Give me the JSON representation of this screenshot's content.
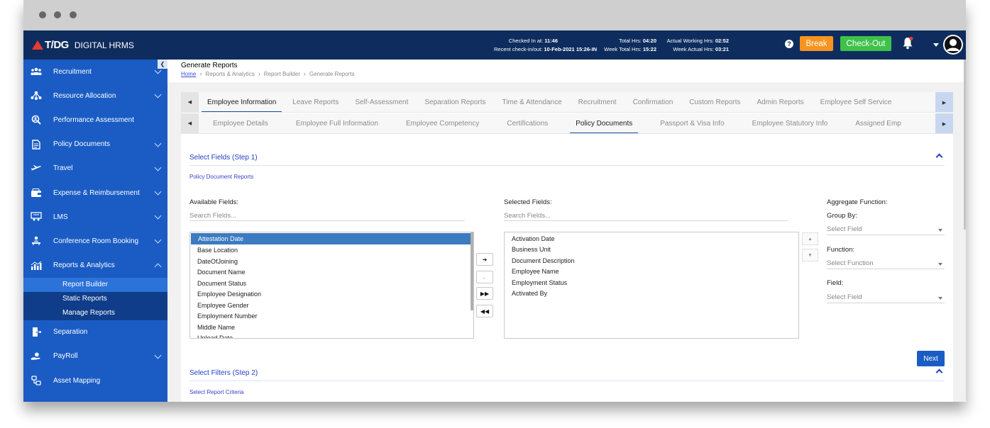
{
  "header": {
    "logo_brand": "T/DG",
    "logo_name": "DIGITAL HRMS",
    "checked_in_label": "Checked In at:",
    "checked_in_value": "11:46",
    "recent_label": "Recent check-in/out:",
    "recent_value": "10-Feb-2021 15:26-IN",
    "total_hrs_label": "Total Hrs:",
    "total_hrs_value": "04:20",
    "week_total_label": "Week Total Hrs:",
    "week_total_value": "15:22",
    "actual_working_label": "Actual Working Hrs:",
    "actual_working_value": "02:52",
    "week_actual_label": "Week Actual Hrs:",
    "week_actual_value": "03:21",
    "break_label": "Break",
    "checkout_label": "Check-Out",
    "help_icon": "?",
    "colors": {
      "bar": "#0e2d5e",
      "break": "#f7931e",
      "checkout": "#3ec24a",
      "notify_dot": "#e63b2e"
    }
  },
  "sidebar": {
    "items": [
      {
        "label": "Recruitment",
        "icon": "people-icon",
        "expandable": true
      },
      {
        "label": "Resource Allocation",
        "icon": "network-icon",
        "expandable": true
      },
      {
        "label": "Performance Assessment",
        "icon": "search-person-icon",
        "expandable": false
      },
      {
        "label": "Policy Documents",
        "icon": "document-icon",
        "expandable": true
      },
      {
        "label": "Travel",
        "icon": "plane-icon",
        "expandable": true
      },
      {
        "label": "Expense & Reimbursement",
        "icon": "wallet-icon",
        "expandable": true
      },
      {
        "label": "LMS",
        "icon": "classroom-icon",
        "expandable": true
      },
      {
        "label": "Conference Room Booking",
        "icon": "meeting-icon",
        "expandable": true
      },
      {
        "label": "Reports & Analytics",
        "icon": "bar-chart-icon",
        "expandable": true,
        "open": true
      }
    ],
    "sub_items": [
      {
        "label": "Report Builder",
        "active": true
      },
      {
        "label": "Static Reports",
        "active": false
      },
      {
        "label": "Manage Reports",
        "active": false
      }
    ],
    "items_after": [
      {
        "label": "Separation",
        "icon": "exit-icon",
        "expandable": false
      },
      {
        "label": "PayRoll",
        "icon": "money-hand-icon",
        "expandable": true
      },
      {
        "label": "Asset Mapping",
        "icon": "asset-icon",
        "expandable": false
      }
    ]
  },
  "page": {
    "title": "Generate Reports",
    "breadcrumbs": [
      "Home",
      "Reports & Analytics",
      "Report Builder",
      "Generate Reports"
    ]
  },
  "tabs_primary": [
    "Employee Information",
    "Leave Reports",
    "Self-Assessment",
    "Separation Reports",
    "Time & Attendance",
    "Recruitment",
    "Confirmation",
    "Custom Reports",
    "Admin Reports",
    "Employee Self Service"
  ],
  "tabs_primary_active": 0,
  "tabs_secondary": [
    "Employee Details",
    "Employee Full Information",
    "Employee Competency",
    "Certifications",
    "Policy Documents",
    "Passport & Visa Info",
    "Employee Statutory Info",
    "Assigned Emp"
  ],
  "tabs_secondary_active": 4,
  "step1": {
    "title": "Select Fields (Step 1)",
    "link": "Policy Document Reports",
    "available_label": "Available Fields:",
    "selected_label": "Selected Fields:",
    "search_placeholder": "Search Fields...",
    "available_fields": [
      "Attestation Date",
      "Base Location",
      "DateOfJoining",
      "Document Name",
      "Document Status",
      "Employee Designation",
      "Employee Gender",
      "Employment Number",
      "Middle Name",
      "Upload Date"
    ],
    "available_selected_index": 0,
    "selected_fields": [
      "Activation Date",
      "Business Unit",
      "Document Description",
      "Employee Name",
      "Employment Status",
      "Activated By"
    ],
    "aggregate_label": "Aggregate Function:",
    "group_by_label": "Group By:",
    "group_by_value": "Select Field",
    "function_label": "Function:",
    "function_value": "Select Function",
    "field_label": "Field:",
    "field_value": "Select Field",
    "next_label": "Next"
  },
  "step2": {
    "title": "Select Filters (Step 2)",
    "link": "Select Report Criteria"
  }
}
